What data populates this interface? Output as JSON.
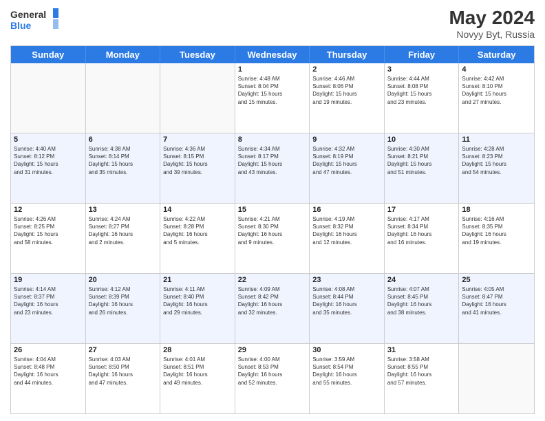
{
  "header": {
    "logo_line1": "General",
    "logo_line2": "Blue",
    "month": "May 2024",
    "location": "Novyy Byt, Russia"
  },
  "days_of_week": [
    "Sunday",
    "Monday",
    "Tuesday",
    "Wednesday",
    "Thursday",
    "Friday",
    "Saturday"
  ],
  "weeks": [
    [
      {
        "day": "",
        "info": ""
      },
      {
        "day": "",
        "info": ""
      },
      {
        "day": "",
        "info": ""
      },
      {
        "day": "1",
        "info": "Sunrise: 4:48 AM\nSunset: 8:04 PM\nDaylight: 15 hours\nand 15 minutes."
      },
      {
        "day": "2",
        "info": "Sunrise: 4:46 AM\nSunset: 8:06 PM\nDaylight: 15 hours\nand 19 minutes."
      },
      {
        "day": "3",
        "info": "Sunrise: 4:44 AM\nSunset: 8:08 PM\nDaylight: 15 hours\nand 23 minutes."
      },
      {
        "day": "4",
        "info": "Sunrise: 4:42 AM\nSunset: 8:10 PM\nDaylight: 15 hours\nand 27 minutes."
      }
    ],
    [
      {
        "day": "5",
        "info": "Sunrise: 4:40 AM\nSunset: 8:12 PM\nDaylight: 15 hours\nand 31 minutes."
      },
      {
        "day": "6",
        "info": "Sunrise: 4:38 AM\nSunset: 8:14 PM\nDaylight: 15 hours\nand 35 minutes."
      },
      {
        "day": "7",
        "info": "Sunrise: 4:36 AM\nSunset: 8:15 PM\nDaylight: 15 hours\nand 39 minutes."
      },
      {
        "day": "8",
        "info": "Sunrise: 4:34 AM\nSunset: 8:17 PM\nDaylight: 15 hours\nand 43 minutes."
      },
      {
        "day": "9",
        "info": "Sunrise: 4:32 AM\nSunset: 8:19 PM\nDaylight: 15 hours\nand 47 minutes."
      },
      {
        "day": "10",
        "info": "Sunrise: 4:30 AM\nSunset: 8:21 PM\nDaylight: 15 hours\nand 51 minutes."
      },
      {
        "day": "11",
        "info": "Sunrise: 4:28 AM\nSunset: 8:23 PM\nDaylight: 15 hours\nand 54 minutes."
      }
    ],
    [
      {
        "day": "12",
        "info": "Sunrise: 4:26 AM\nSunset: 8:25 PM\nDaylight: 15 hours\nand 58 minutes."
      },
      {
        "day": "13",
        "info": "Sunrise: 4:24 AM\nSunset: 8:27 PM\nDaylight: 16 hours\nand 2 minutes."
      },
      {
        "day": "14",
        "info": "Sunrise: 4:22 AM\nSunset: 8:28 PM\nDaylight: 16 hours\nand 5 minutes."
      },
      {
        "day": "15",
        "info": "Sunrise: 4:21 AM\nSunset: 8:30 PM\nDaylight: 16 hours\nand 9 minutes."
      },
      {
        "day": "16",
        "info": "Sunrise: 4:19 AM\nSunset: 8:32 PM\nDaylight: 16 hours\nand 12 minutes."
      },
      {
        "day": "17",
        "info": "Sunrise: 4:17 AM\nSunset: 8:34 PM\nDaylight: 16 hours\nand 16 minutes."
      },
      {
        "day": "18",
        "info": "Sunrise: 4:16 AM\nSunset: 8:35 PM\nDaylight: 16 hours\nand 19 minutes."
      }
    ],
    [
      {
        "day": "19",
        "info": "Sunrise: 4:14 AM\nSunset: 8:37 PM\nDaylight: 16 hours\nand 23 minutes."
      },
      {
        "day": "20",
        "info": "Sunrise: 4:12 AM\nSunset: 8:39 PM\nDaylight: 16 hours\nand 26 minutes."
      },
      {
        "day": "21",
        "info": "Sunrise: 4:11 AM\nSunset: 8:40 PM\nDaylight: 16 hours\nand 29 minutes."
      },
      {
        "day": "22",
        "info": "Sunrise: 4:09 AM\nSunset: 8:42 PM\nDaylight: 16 hours\nand 32 minutes."
      },
      {
        "day": "23",
        "info": "Sunrise: 4:08 AM\nSunset: 8:44 PM\nDaylight: 16 hours\nand 35 minutes."
      },
      {
        "day": "24",
        "info": "Sunrise: 4:07 AM\nSunset: 8:45 PM\nDaylight: 16 hours\nand 38 minutes."
      },
      {
        "day": "25",
        "info": "Sunrise: 4:05 AM\nSunset: 8:47 PM\nDaylight: 16 hours\nand 41 minutes."
      }
    ],
    [
      {
        "day": "26",
        "info": "Sunrise: 4:04 AM\nSunset: 8:48 PM\nDaylight: 16 hours\nand 44 minutes."
      },
      {
        "day": "27",
        "info": "Sunrise: 4:03 AM\nSunset: 8:50 PM\nDaylight: 16 hours\nand 47 minutes."
      },
      {
        "day": "28",
        "info": "Sunrise: 4:01 AM\nSunset: 8:51 PM\nDaylight: 16 hours\nand 49 minutes."
      },
      {
        "day": "29",
        "info": "Sunrise: 4:00 AM\nSunset: 8:53 PM\nDaylight: 16 hours\nand 52 minutes."
      },
      {
        "day": "30",
        "info": "Sunrise: 3:59 AM\nSunset: 8:54 PM\nDaylight: 16 hours\nand 55 minutes."
      },
      {
        "day": "31",
        "info": "Sunrise: 3:58 AM\nSunset: 8:55 PM\nDaylight: 16 hours\nand 57 minutes."
      },
      {
        "day": "",
        "info": ""
      }
    ]
  ]
}
